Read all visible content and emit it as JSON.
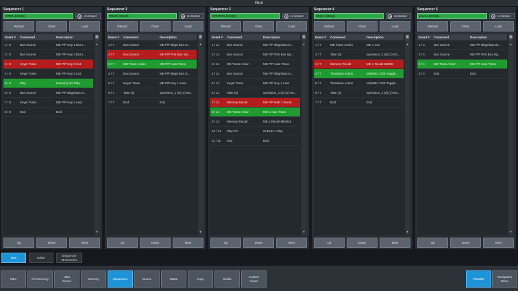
{
  "window": {
    "title": "Run"
  },
  "buttons": {
    "reload": "Reload",
    "clear": "Clear",
    "load": "Load",
    "up": "Up",
    "down": "Down",
    "next": "Next",
    "unlimited": "Unlimited"
  },
  "table_headers": {
    "event": "Event #",
    "command": "Command",
    "description": "Description"
  },
  "sequencers": [
    {
      "title": "Sequencer 1",
      "name": "OPEN [SEQ1]",
      "rows": [
        {
          "event": "1 / 8",
          "command": "Bus Source",
          "description": "ME P/P Key 1 Bus I...",
          "state": "normal"
        },
        {
          "event": "2 / 8",
          "command": "Bus Source",
          "description": "ME P/P Key 2 Bus I...",
          "state": "normal"
        },
        {
          "event": "3 / 8",
          "command": "Keyer Trans",
          "description": "ME P/P Key 1 Cut",
          "state": "red"
        },
        {
          "event": "4 / 8",
          "command": "Keyer Trans",
          "description": "ME P/P Key 2 Cut",
          "state": "normal"
        },
        {
          "event": "5 / 8",
          "command": "Play",
          "description": "Name(1)-S2 Play",
          "state": "green"
        },
        {
          "event": "6 / 8",
          "command": "Bus Source",
          "description": "ME P/P Bkgd Bus In...",
          "state": "normal"
        },
        {
          "event": "7 / 8",
          "command": "Keyer Trans",
          "description": "ME P/P Key 2 Auto",
          "state": "normal"
        },
        {
          "event": "8 / 8",
          "command": "End",
          "description": "End",
          "state": "normal"
        }
      ]
    },
    {
      "title": "Sequencer 2",
      "name": "PGM2 [SEQ2]",
      "rows": [
        {
          "event": "1 / 7",
          "command": "Bus Source",
          "description": "ME P/P Bkgd Bus In...",
          "state": "normal"
        },
        {
          "event": "2 / 7",
          "command": "Bus Source",
          "description": "ME P/P Prst Bus Inp...",
          "state": "red"
        },
        {
          "event": "3 / 7",
          "command": "ME Trans Action",
          "description": "ME P/P Auto Trans",
          "state": "green"
        },
        {
          "event": "4 / 7",
          "command": "Bus Source",
          "description": "ME P/P Bkgd Bus In...",
          "state": "normal"
        },
        {
          "event": "5 / 7",
          "command": "Keyer Trans",
          "description": "ME P/P Key 1 Auto...",
          "state": "normal"
        },
        {
          "event": "6 / 7",
          "command": "Take (3)",
          "description": "xpression_1 (0) (1)-S0...",
          "state": "normal"
        },
        {
          "event": "7 / 7",
          "command": "End",
          "description": "End",
          "state": "normal"
        }
      ]
    },
    {
      "title": "Sequencer 3",
      "name": "SPORTS [SEQ3]",
      "rows": [
        {
          "event": "1 / 11",
          "command": "Bus Source",
          "description": "ME P/P Bkgd Bus In...",
          "state": "normal"
        },
        {
          "event": "2 / 11",
          "command": "Bus Source",
          "description": "ME P/P Prst Bus Inp...",
          "state": "normal"
        },
        {
          "event": "3 / 11",
          "command": "ME Trans Action",
          "description": "ME P/P Auto Trans",
          "state": "normal"
        },
        {
          "event": "4 / 11",
          "command": "Bus Source",
          "description": "ME P/P Bkgd Bus In...",
          "state": "normal"
        },
        {
          "event": "5 / 11",
          "command": "Keyer Trans",
          "description": "ME P/P Key 1 Auto",
          "state": "normal"
        },
        {
          "event": "6 / 11",
          "command": "Take (3)",
          "description": "xpression_1 (0) (1)-S0...",
          "state": "normal"
        },
        {
          "event": "7 / 11",
          "command": "Memory Recall",
          "description": "ME P/P+ME 1 Recal...",
          "state": "red"
        },
        {
          "event": "8 / 11",
          "command": "ME Trans Action",
          "description": "ME 1 Auto Trans",
          "state": "green"
        },
        {
          "event": "9 / 11",
          "command": "Memory Recall",
          "description": "ME 1 Recall MEM19",
          "state": "normal"
        },
        {
          "event": "10 / 11",
          "command": "Play CC",
          "description": "CLEAR 1 Play",
          "state": "normal"
        },
        {
          "event": "11 / 11",
          "command": "End",
          "description": "End",
          "state": "normal"
        }
      ]
    },
    {
      "title": "Sequencer 4",
      "name": "SEQ4 [SEQ4]",
      "rows": [
        {
          "event": "1 / 7",
          "command": "ME Trans Action",
          "description": "ME 1 Cut",
          "state": "normal"
        },
        {
          "event": "2 / 7",
          "command": "Take (3)",
          "description": "xpression_1 (0) (1)-S0...",
          "state": "normal"
        },
        {
          "event": "3 / 7",
          "command": "Memory Recall",
          "description": "ME 1 Recall MEM8",
          "state": "red"
        },
        {
          "event": "4 / 7",
          "command": "Transition Action",
          "description": "MiniME1 DVE Toggle...",
          "state": "green"
        },
        {
          "event": "5 / 7",
          "command": "Transition Action",
          "description": "MiniME1 DVE Toggle...",
          "state": "normal"
        },
        {
          "event": "6 / 7",
          "command": "Take (3)",
          "description": "xpression_1 (0) (1)-S0...",
          "state": "normal"
        },
        {
          "event": "7 / 7",
          "command": "End",
          "description": "End",
          "state": "normal"
        }
      ]
    },
    {
      "title": "Sequencer 5",
      "name": "promo [SEQ5]",
      "rows": [
        {
          "event": "1 / 4",
          "command": "Bus Source",
          "description": "ME P/P Bkgd Bus IN...",
          "state": "normal"
        },
        {
          "event": "2 / 4",
          "command": "Bus Source",
          "description": "ME P/P Prst Bus Inp...",
          "state": "normal"
        },
        {
          "event": "3 / 4",
          "command": "ME Trans Action",
          "description": "ME P/P Auto Trans",
          "state": "green"
        },
        {
          "event": "4 / 4",
          "command": "End",
          "description": "End",
          "state": "normal"
        }
      ]
    }
  ],
  "mode_tabs": [
    {
      "label": "Run",
      "active": true
    },
    {
      "label": "Editor",
      "active": false
    },
    {
      "label_line1": "Sequencer",
      "label_line2": "Mnemonics",
      "active": false
    }
  ],
  "nav": [
    {
      "label": "MEs"
    },
    {
      "label": "Chroma Key"
    },
    {
      "label_line1": "Ultra",
      "label_line2": "Scene"
    },
    {
      "label": "Memory"
    },
    {
      "label": "Sequencer",
      "active": true
    },
    {
      "label": "Buses"
    },
    {
      "label": "Matte"
    },
    {
      "label": "Copy"
    },
    {
      "label": "Media"
    },
    {
      "label_line1": "Custom",
      "label_line2": "Views"
    },
    {
      "label": "PanelUI",
      "active": true
    },
    {
      "label_line1": "Navigation",
      "label_line2": "Menu"
    }
  ],
  "colors": {
    "accent_blue": "#1e94d8",
    "row_red": "#b51d1d",
    "row_green": "#1f9c2f",
    "name_green": "#2fa64a"
  }
}
